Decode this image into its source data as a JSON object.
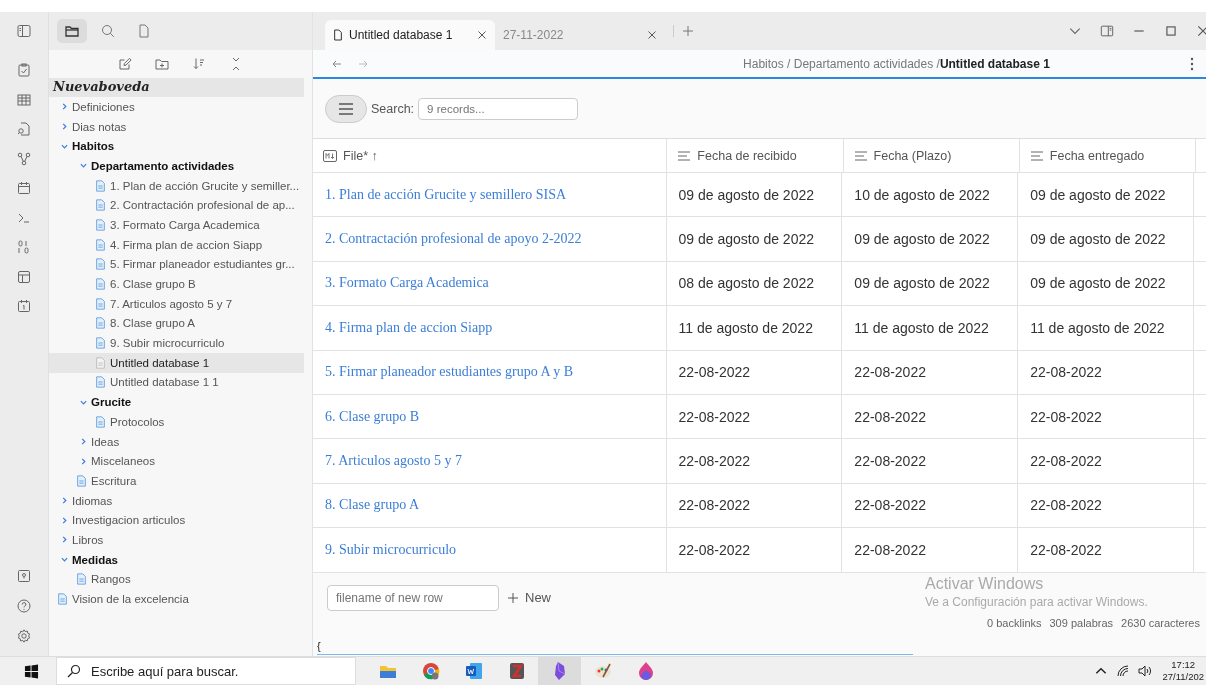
{
  "sidebar_tabs": [
    {
      "kind": "folder",
      "selected": true
    },
    {
      "kind": "search",
      "selected": false
    },
    {
      "kind": "file",
      "selected": false
    }
  ],
  "vault": {
    "name": "Nuevaboveda",
    "selected": true
  },
  "tree": [
    {
      "kind": "folder",
      "name": "Definiciones",
      "expanded": false,
      "selected": false
    },
    {
      "kind": "folder",
      "name": "Dias notas",
      "expanded": false,
      "selected": false
    },
    {
      "kind": "folder",
      "name": "Habitos",
      "expanded": true,
      "selected": false,
      "children": [
        {
          "kind": "folder",
          "name": "Departamento actividades",
          "expanded": true,
          "selected": false,
          "children": [
            {
              "kind": "file",
              "name": "1. Plan de acción Grucite y semiller...",
              "selected": false
            },
            {
              "kind": "file",
              "name": "2. Contractación profesional de ap...",
              "selected": false
            },
            {
              "kind": "file",
              "name": "3. Formato Carga Academica",
              "selected": false
            },
            {
              "kind": "file",
              "name": "4. Firma plan de accion Siapp",
              "selected": false
            },
            {
              "kind": "file",
              "name": "5. Firmar planeador estudiantes gr...",
              "selected": false
            },
            {
              "kind": "file",
              "name": "6. Clase grupo B",
              "selected": false
            },
            {
              "kind": "file",
              "name": "7. Articulos agosto 5 y 7",
              "selected": false
            },
            {
              "kind": "file",
              "name": "8. Clase grupo A",
              "selected": false
            },
            {
              "kind": "file",
              "name": "9. Subir microcurriculo",
              "selected": false
            },
            {
              "kind": "file",
              "name": "Untitled database 1",
              "selected": true
            },
            {
              "kind": "file",
              "name": "Untitled database 1 1",
              "selected": false
            }
          ]
        },
        {
          "kind": "folder",
          "name": "Grucite",
          "expanded": true,
          "selected": false,
          "children": [
            {
              "kind": "file",
              "name": "Protocolos",
              "selected": false
            }
          ]
        },
        {
          "kind": "folder",
          "name": "Ideas",
          "expanded": false,
          "selected": false
        },
        {
          "kind": "folder",
          "name": "Miscelaneos",
          "expanded": false,
          "selected": false
        },
        {
          "kind": "file",
          "name": "Escritura",
          "selected": false
        }
      ]
    },
    {
      "kind": "folder",
      "name": "Idiomas",
      "expanded": false,
      "selected": false
    },
    {
      "kind": "folder",
      "name": "Investigacion articulos",
      "expanded": false,
      "selected": false
    },
    {
      "kind": "folder",
      "name": "Libros",
      "expanded": false,
      "selected": false
    },
    {
      "kind": "folder",
      "name": "Medidas",
      "expanded": true,
      "selected": false,
      "children": [
        {
          "kind": "file",
          "name": "Rangos",
          "selected": false
        }
      ]
    },
    {
      "kind": "file",
      "name": "Vision de la excelencia",
      "selected": false
    }
  ],
  "tabs": [
    {
      "title": "Untitled database 1",
      "selected": true
    },
    {
      "title": "27-11-2022",
      "selected": false
    }
  ],
  "breadcrumb": [
    {
      "text": "Habitos / Departamento actividades /",
      "current": false
    },
    {
      "text": "Untitled database 1",
      "current": true
    }
  ],
  "search": {
    "label": "Search:",
    "placeholder": "9 records..."
  },
  "table": {
    "columns": [
      {
        "kind": "file",
        "label": "File* ↑"
      },
      {
        "kind": "text",
        "label": "Fecha de recibido"
      },
      {
        "kind": "text",
        "label": "Fecha (Plazo)"
      },
      {
        "kind": "text",
        "label": "Fecha entregado"
      }
    ],
    "rows": [
      [
        "1. Plan de acción Grucite y semillero SISA",
        "09 de agosto de 2022",
        "10 de agosto de 2022",
        "09 de agosto de 2022"
      ],
      [
        "2. Contractación profesional de apoyo 2-2022",
        "09 de agosto de 2022",
        "09 de agosto de 2022",
        "09 de agosto de 2022"
      ],
      [
        "3. Formato Carga Academica",
        "08 de agosto de 2022",
        "09 de agosto de 2022",
        "09 de agosto de 2022"
      ],
      [
        "4. Firma plan de accion Siapp",
        "11 de agosto de 2022",
        "11 de agosto de 2022",
        "11 de agosto de 2022"
      ],
      [
        "5. Firmar planeador estudiantes grupo A y B",
        "22-08-2022",
        "22-08-2022",
        "22-08-2022"
      ],
      [
        "6. Clase grupo B",
        "22-08-2022",
        "22-08-2022",
        "22-08-2022"
      ],
      [
        "7. Articulos agosto 5 y 7",
        "22-08-2022",
        "22-08-2022",
        "22-08-2022"
      ],
      [
        "8. Clase grupo A",
        "22-08-2022",
        "22-08-2022",
        "22-08-2022"
      ],
      [
        "9. Subir microcurriculo",
        "22-08-2022",
        "22-08-2022",
        "22-08-2022"
      ]
    ]
  },
  "new_row": {
    "placeholder": "filename of new row",
    "button": "New"
  },
  "editor_text": "{",
  "status": [
    "0 backlinks",
    "309 palabras",
    "2630 caracteres"
  ],
  "activation": {
    "title": "Activar Windows",
    "text": "Ve a Configuración para activar Windows."
  },
  "taskbar": {
    "search_placeholder": "Escribe aquí para buscar.",
    "apps": [
      {
        "kind": "explorer",
        "selected": false
      },
      {
        "kind": "chrome",
        "selected": false
      },
      {
        "kind": "word",
        "selected": false
      },
      {
        "kind": "zotero",
        "selected": false
      },
      {
        "kind": "obsidian",
        "selected": true
      },
      {
        "kind": "paint",
        "selected": false
      },
      {
        "kind": "fluent",
        "selected": false
      }
    ],
    "time": "17:12",
    "date": "27/11/202"
  }
}
